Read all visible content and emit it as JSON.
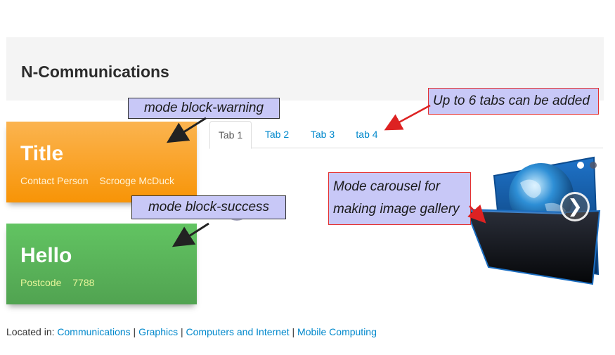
{
  "header": {
    "title": "N-Communications"
  },
  "block_warning": {
    "title": "Title",
    "meta_label": "Contact Person",
    "meta_value": "Scrooge McDuck"
  },
  "block_success": {
    "title": "Hello",
    "meta_label": "Postcode",
    "meta_value": "7788"
  },
  "tabs": [
    {
      "label": "Tab 1",
      "active": true
    },
    {
      "label": "Tab 2",
      "active": false
    },
    {
      "label": "Tab 3",
      "active": false
    },
    {
      "label": "tab 4",
      "active": false
    }
  ],
  "carousel": {
    "prev_glyph": "‹",
    "next_glyph": "❯",
    "slides_total": 2,
    "current_slide": 1
  },
  "annotations": {
    "block_warning": "mode block-warning",
    "block_success": "mode block-success",
    "tabs": "Up to 6 tabs can be added",
    "carousel_line1": "Mode carousel for",
    "carousel_line2": "making image gallery"
  },
  "footer": {
    "prefix": "Located in:",
    "links": [
      "Communications",
      "Graphics",
      "Computers and Internet",
      "Mobile Computing"
    ],
    "separator": "|"
  },
  "colors": {
    "warning": "#f89406",
    "success": "#51a351",
    "link": "#0088cc",
    "annotation_bg": "#c8c8f7",
    "annotation_border_red": "#e53030"
  }
}
